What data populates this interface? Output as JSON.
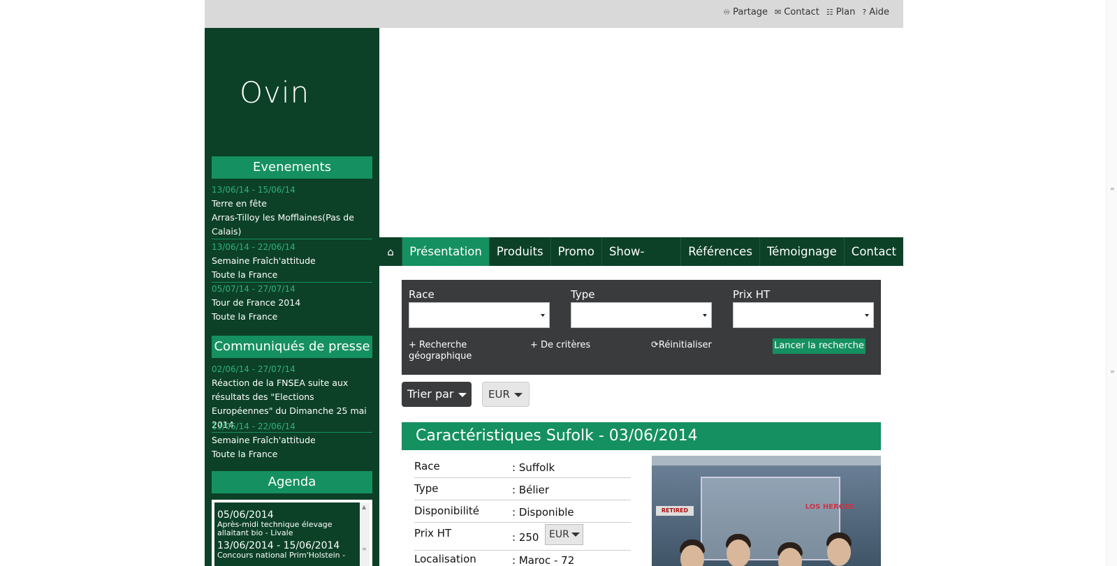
{
  "toplinks": [
    {
      "icon": "share-icon",
      "label": "Partage"
    },
    {
      "icon": "envelope-icon",
      "label": "Contact"
    },
    {
      "icon": "sitemap-icon",
      "label": "Plan"
    },
    {
      "icon": "question-icon",
      "label": "Aide"
    }
  ],
  "sidebar": {
    "logo": "Ovin",
    "events_title": "Evenements",
    "events": [
      {
        "date": "13/06/14 - 15/06/14",
        "title": "Terre en fête",
        "place": "Arras-Tilloy les Mofflaines(Pas de Calais)"
      },
      {
        "date": "13/06/14 - 22/06/14",
        "title": "Semaine Fraîch'attitude",
        "place": "Toute la France"
      },
      {
        "date": "05/07/14 - 27/07/14",
        "title": "Tour de France 2014",
        "place": "Toute la France"
      }
    ],
    "press_title": "Communiqués de presse",
    "press": [
      {
        "date": "02/06/14 - 27/07/14",
        "text": "Réaction de la FNSEA suite aux résultats des \"Elections Européennes\" du Dimanche 25 mai 2014"
      },
      {
        "date": "13/06/14 - 22/06/14",
        "text": "Semaine Fraîch'attitude",
        "place": "Toute la France"
      }
    ],
    "agenda_title": "Agenda",
    "agenda": [
      {
        "date": "05/06/2014",
        "desc": "Après-midi technique élevage allaitant bio - Livale"
      },
      {
        "date": "13/06/2014 - 15/06/2014",
        "desc": "Concours national Prim'Holstein -"
      }
    ]
  },
  "nav": {
    "home_icon": "home-icon",
    "items": [
      "Présentation",
      "Produits",
      "Promo",
      "Show-Room",
      "Références",
      "Témoignage",
      "Contact"
    ]
  },
  "search": {
    "race_label": "Race",
    "type_label": "Type",
    "prix_label": "Prix HT",
    "geo_link": "+ Recherche géographique",
    "criteria_link": "+ De critères",
    "reset_link": "Réinitialiser",
    "submit": "Lancer la recherche"
  },
  "sort": {
    "label": "Trier par",
    "currency": "EUR"
  },
  "detail": {
    "title": "Caractéristiques Sufolk - 03/06/2014",
    "specs": [
      {
        "key": "Race",
        "value": ": Suffolk"
      },
      {
        "key": "Type",
        "value": ": Bélier"
      },
      {
        "key": "Disponibilité",
        "value": ": Disponible"
      },
      {
        "key": "Prix HT",
        "value": ": 250",
        "currency": "EUR"
      },
      {
        "key": "Localisation",
        "value": ": Maroc - 72"
      }
    ],
    "photo_signs": [
      "RETIRED",
      "LOS HEROES"
    ]
  }
}
